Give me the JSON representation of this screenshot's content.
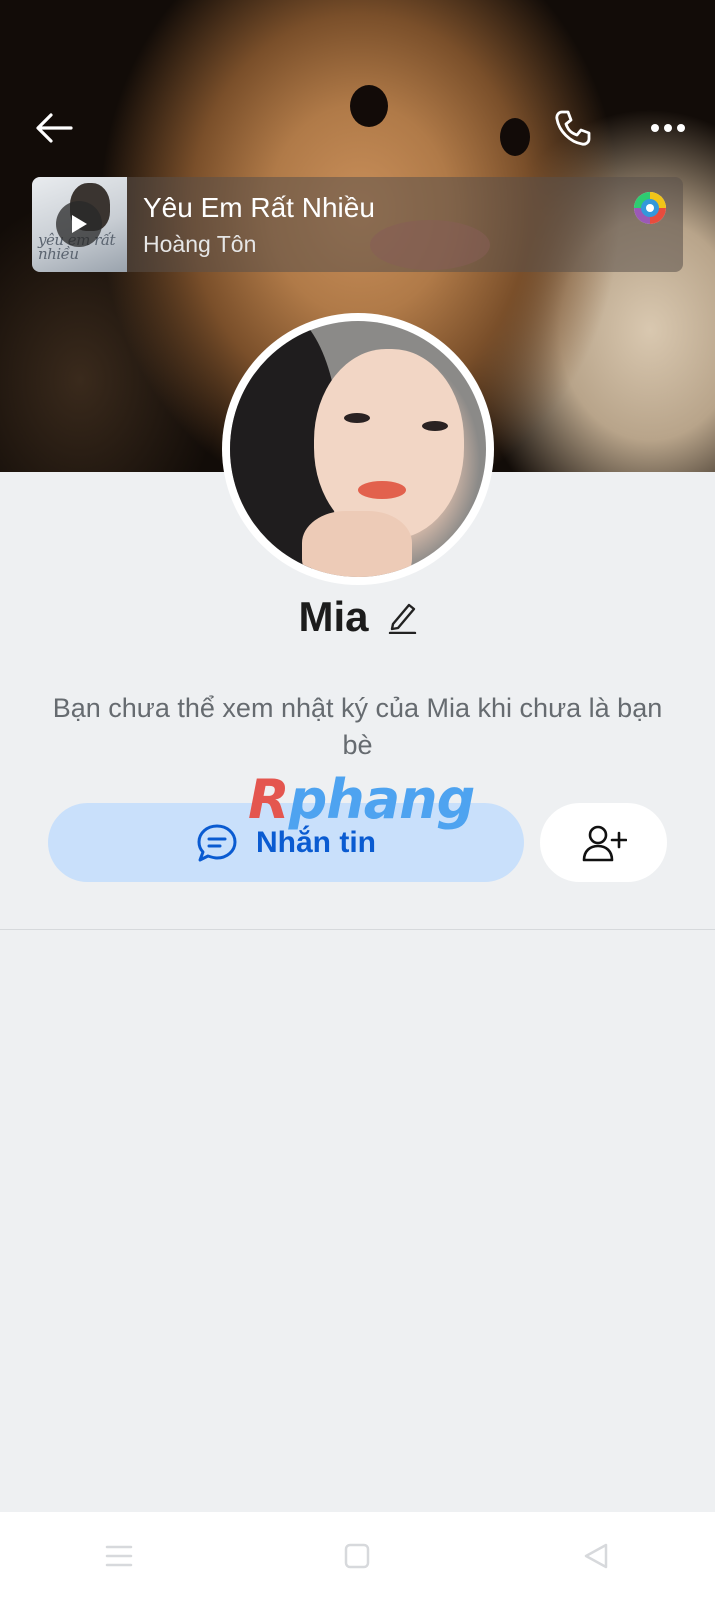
{
  "header": {
    "back_icon": "arrow-left-icon",
    "call_icon": "phone-icon",
    "more_icon": "more-horizontal-icon"
  },
  "music": {
    "title": "Yêu Em Rất Nhiều",
    "artist": "Hoàng Tôn",
    "album_text": "yêu em rất nhiều",
    "play_icon": "play-icon",
    "disc_icon": "music-disc-icon"
  },
  "profile": {
    "name": "Mia",
    "edit_icon": "pencil-icon",
    "info": "Bạn chưa thể xem nhật ký của Mia khi chưa là bạn bè"
  },
  "watermark": {
    "part1": "R",
    "part2": "phang"
  },
  "actions": {
    "message_label": "Nhắn tin",
    "message_icon": "chat-bubble-icon",
    "add_friend_icon": "add-friend-icon"
  },
  "colors": {
    "accent": "#0a5bd1",
    "message_bg": "#c9e0fb",
    "page_bg": "#eef0f2"
  }
}
